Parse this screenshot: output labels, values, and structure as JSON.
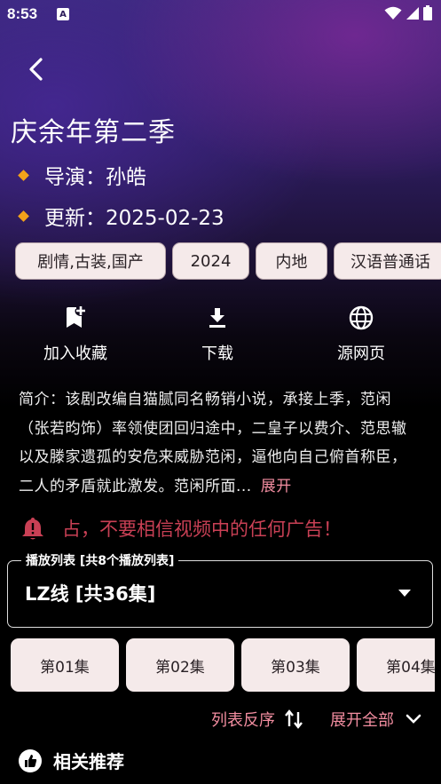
{
  "status_bar": {
    "time": "8:53",
    "notification_badge": "A"
  },
  "header": {
    "title": "庆余年第二季",
    "director": "导演：孙皓",
    "updated": "更新：2025-02-23"
  },
  "tags": [
    "剧情,古装,国产",
    "2024",
    "内地",
    "汉语普通话"
  ],
  "actions": [
    {
      "label": "加入收藏",
      "icon": "bookmark-add-icon"
    },
    {
      "label": "下载",
      "icon": "download-icon"
    },
    {
      "label": "源网页",
      "icon": "globe-icon"
    }
  ],
  "synopsis": {
    "text": "简介：该剧改编自猫腻同名畅销小说，承接上季，范闲（张若昀饰）率领使团回归途中，二皇子以费介、范思辙以及滕家遗孤的安危来威胁范闲，逼他向自己俯首称臣，二人的矛盾就此激发。范闲所面...",
    "expand_label": "展开"
  },
  "warning": {
    "text": "占，不要相信视频中的任何广告！"
  },
  "playlist": {
    "legend": "播放列表 [共8个播放列表]",
    "selected": "LZ线 [共36集]"
  },
  "episodes": [
    "第01集",
    "第02集",
    "第03集",
    "第04集"
  ],
  "list_controls": {
    "reverse_label": "列表反序",
    "expand_all_label": "展开全部"
  },
  "related": {
    "label": "相关推荐"
  },
  "colors": {
    "accent_pink": "#f28da0",
    "warning_red": "#c94055",
    "chip_bg": "#f5eaea",
    "diamond_orange": "#f2a21a"
  }
}
